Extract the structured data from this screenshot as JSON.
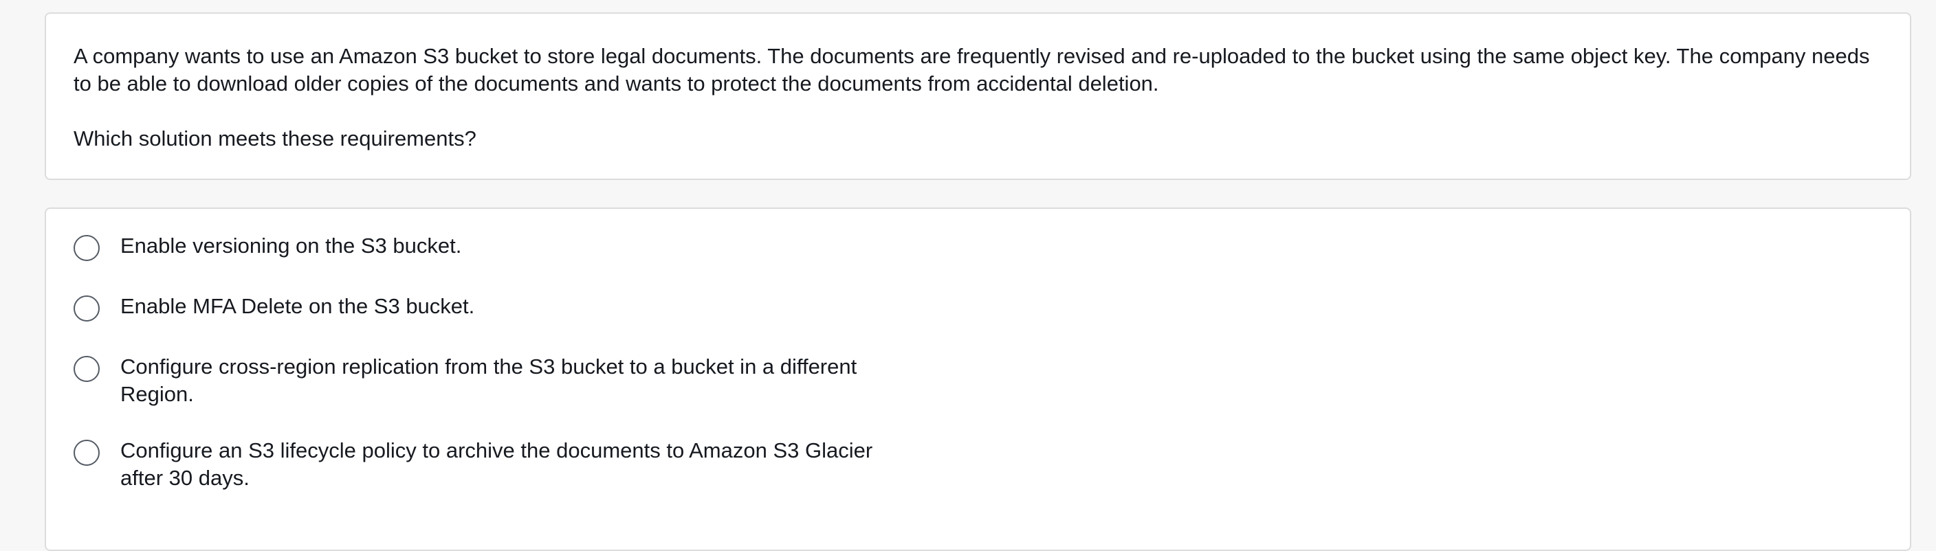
{
  "question": {
    "text": "A company wants to use an Amazon S3 bucket to store legal documents. The documents are frequently revised and re-uploaded to the bucket using the same object key. The company needs to be able to download older copies of the documents and wants to protect the documents from accidental deletion.",
    "prompt": "Which solution meets these requirements?"
  },
  "options": [
    {
      "label": "Enable versioning on the S3 bucket."
    },
    {
      "label": "Enable MFA Delete on the S3 bucket."
    },
    {
      "label": "Configure cross-region replication from the S3 bucket to a bucket in a different Region."
    },
    {
      "label": "Configure an S3 lifecycle policy to archive the documents to Amazon S3 Glacier after 30 days."
    }
  ]
}
